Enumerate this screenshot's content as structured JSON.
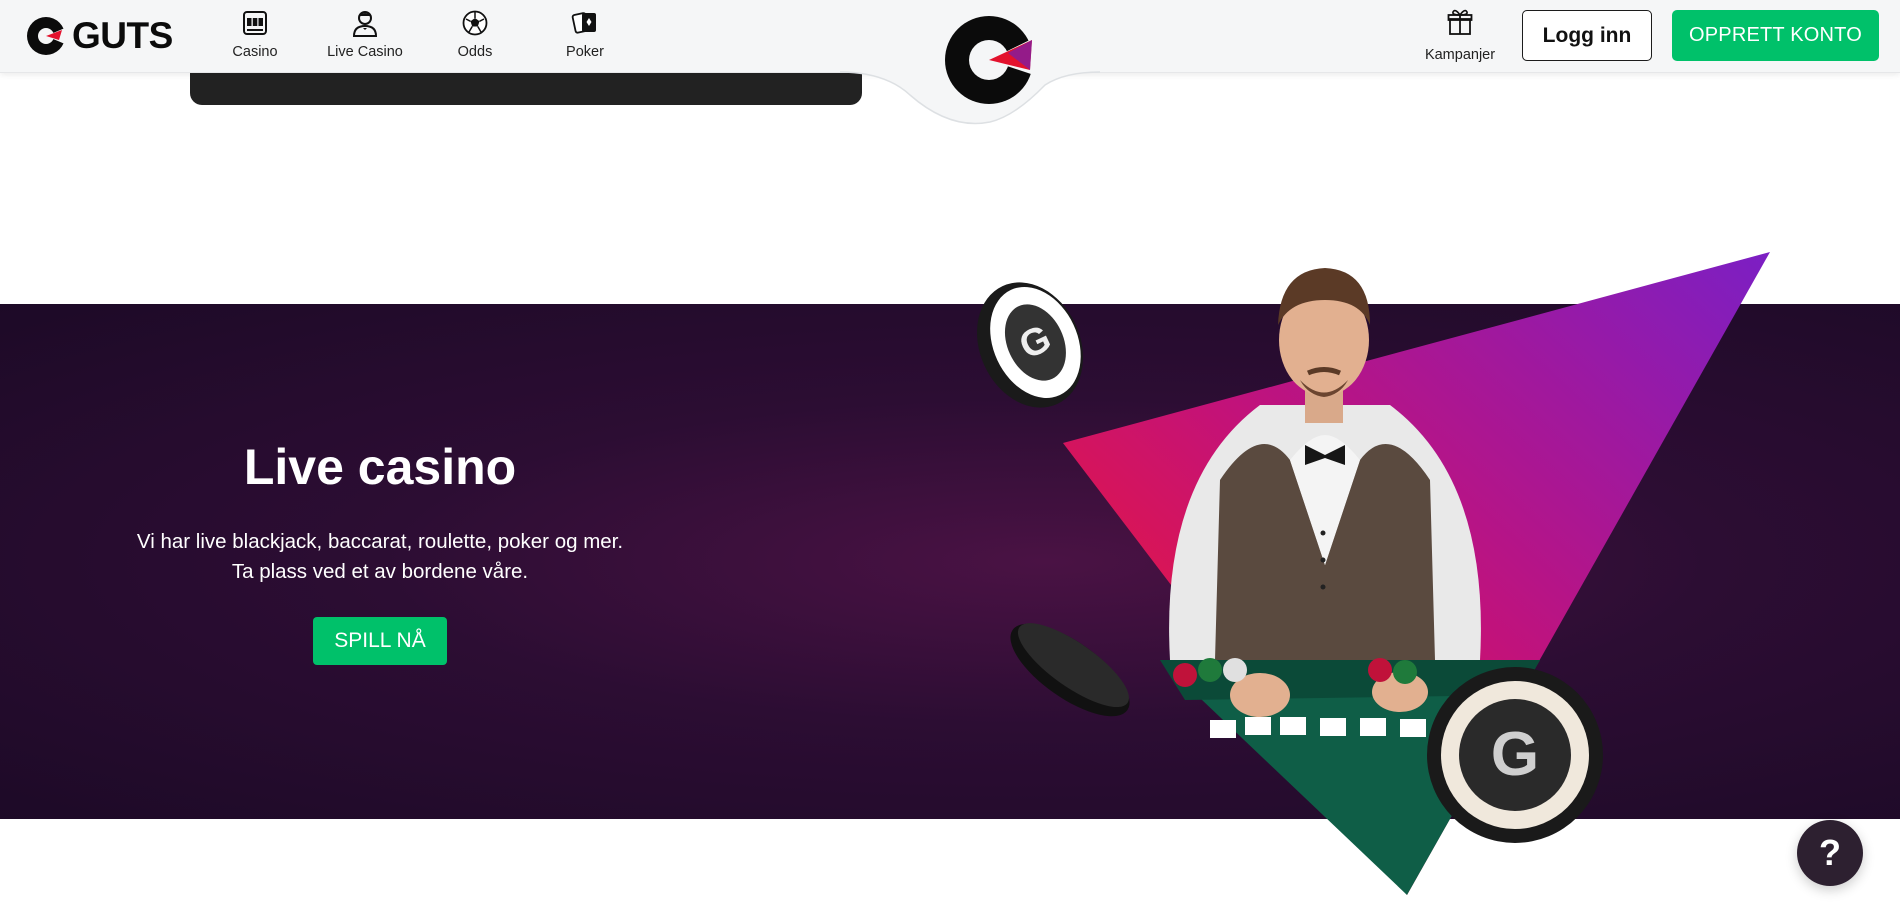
{
  "brand": {
    "name": "GUTS"
  },
  "nav": {
    "items": [
      {
        "label": "Casino",
        "icon": "slot-machine-icon"
      },
      {
        "label": "Live Casino",
        "icon": "dealer-icon"
      },
      {
        "label": "Odds",
        "icon": "football-icon"
      },
      {
        "label": "Poker",
        "icon": "cards-icon"
      }
    ]
  },
  "header": {
    "promotions_label": "Kampanjer",
    "login_label": "Logg inn",
    "signup_label": "OPPRETT KONTO"
  },
  "hero": {
    "title": "Live casino",
    "subtitle_line1": "Vi har live blackjack, baccarat, roulette, poker og mer.",
    "subtitle_line2": "Ta plass ved et av bordene våre.",
    "cta_label": "SPILL NÅ"
  },
  "help": {
    "label": "?"
  },
  "colors": {
    "accent_green": "#00c16a",
    "hero_background": "#2c0d33",
    "logo_red": "#e3122d",
    "logo_purple": "#7a1fa8"
  }
}
